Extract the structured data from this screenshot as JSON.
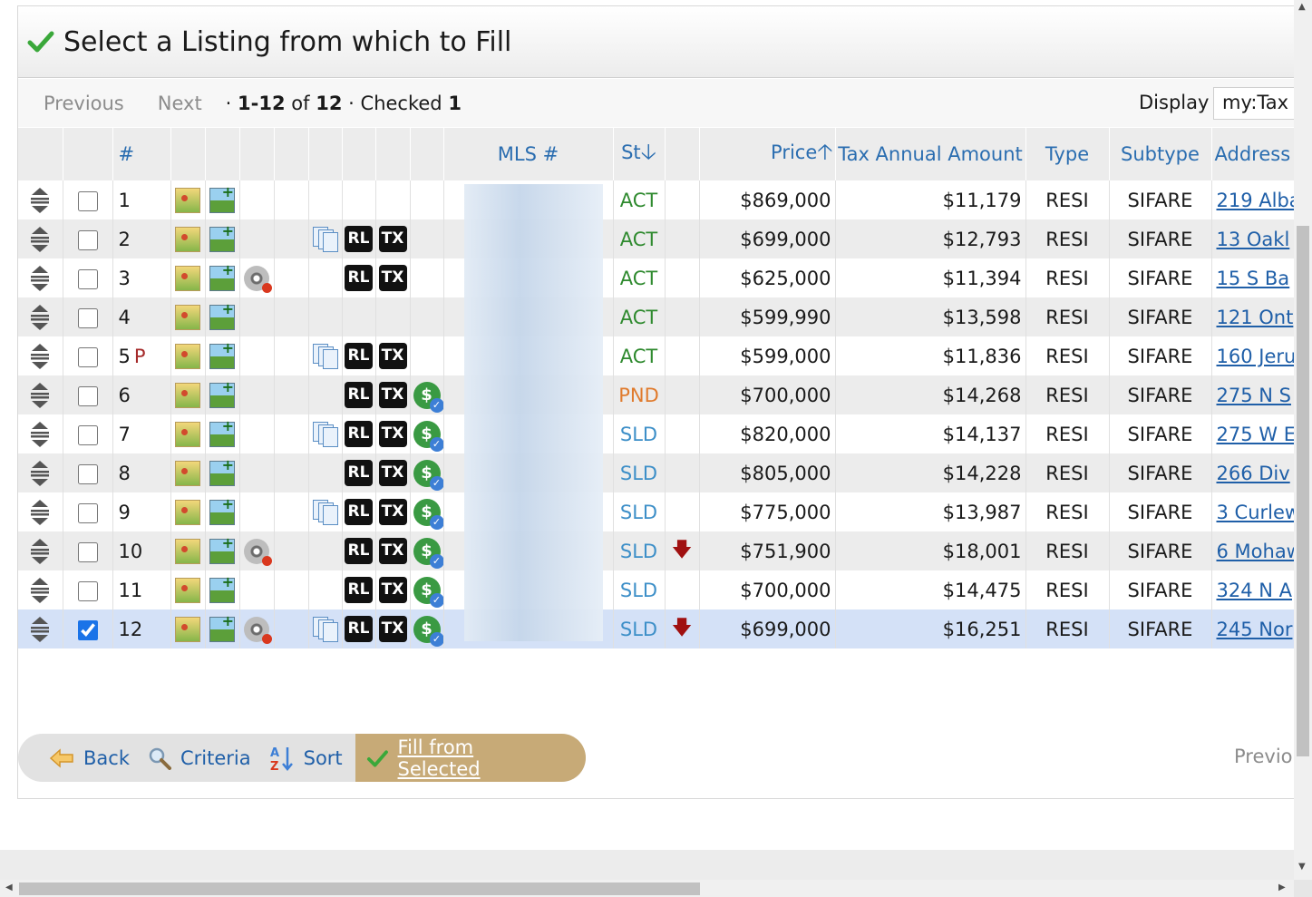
{
  "page": {
    "title": "Select a Listing from which to Fill"
  },
  "pager": {
    "previous": "Previous",
    "next": "Next",
    "sep1": "·",
    "range": "1-12",
    "of": "of",
    "total": "12",
    "sep2": "·",
    "checked_label": "Checked",
    "checked_count": "1",
    "display_label": "Display",
    "display_value": "my:Tax"
  },
  "columns": {
    "num": "#",
    "mls": "MLS #",
    "status": "St",
    "price": "Price",
    "tax": "Tax Annual Amount",
    "type": "Type",
    "subtype": "Subtype",
    "address": "Address"
  },
  "rows": [
    {
      "n": "1",
      "flag": "",
      "checked": false,
      "reel": false,
      "copy": false,
      "rl": false,
      "tx": false,
      "dollar": false,
      "st": "ACT",
      "drop": false,
      "price": "$869,000",
      "tax": "$11,179",
      "type": "RESI",
      "sub": "SIFARE",
      "addr": "219 Alba"
    },
    {
      "n": "2",
      "flag": "",
      "checked": false,
      "reel": false,
      "copy": true,
      "rl": true,
      "tx": true,
      "dollar": false,
      "st": "ACT",
      "drop": false,
      "price": "$699,000",
      "tax": "$12,793",
      "type": "RESI",
      "sub": "SIFARE",
      "addr": "13 Oakl"
    },
    {
      "n": "3",
      "flag": "",
      "checked": false,
      "reel": true,
      "copy": false,
      "rl": true,
      "tx": true,
      "dollar": false,
      "st": "ACT",
      "drop": false,
      "price": "$625,000",
      "tax": "$11,394",
      "type": "RESI",
      "sub": "SIFARE",
      "addr": "15 S Ba"
    },
    {
      "n": "4",
      "flag": "",
      "checked": false,
      "reel": false,
      "copy": false,
      "rl": false,
      "tx": false,
      "dollar": false,
      "st": "ACT",
      "drop": false,
      "price": "$599,990",
      "tax": "$13,598",
      "type": "RESI",
      "sub": "SIFARE",
      "addr": "121 Ont"
    },
    {
      "n": "5",
      "flag": "P",
      "checked": false,
      "reel": false,
      "copy": true,
      "rl": true,
      "tx": true,
      "dollar": false,
      "st": "ACT",
      "drop": false,
      "price": "$599,000",
      "tax": "$11,836",
      "type": "RESI",
      "sub": "SIFARE",
      "addr": "160 Jeru"
    },
    {
      "n": "6",
      "flag": "",
      "checked": false,
      "reel": false,
      "copy": false,
      "rl": true,
      "tx": true,
      "dollar": true,
      "st": "PND",
      "drop": false,
      "price": "$700,000",
      "tax": "$14,268",
      "type": "RESI",
      "sub": "SIFARE",
      "addr": "275 N S"
    },
    {
      "n": "7",
      "flag": "",
      "checked": false,
      "reel": false,
      "copy": true,
      "rl": true,
      "tx": true,
      "dollar": true,
      "st": "SLD",
      "drop": false,
      "price": "$820,000",
      "tax": "$14,137",
      "type": "RESI",
      "sub": "SIFARE",
      "addr": "275 W E"
    },
    {
      "n": "8",
      "flag": "",
      "checked": false,
      "reel": false,
      "copy": false,
      "rl": true,
      "tx": true,
      "dollar": true,
      "st": "SLD",
      "drop": false,
      "price": "$805,000",
      "tax": "$14,228",
      "type": "RESI",
      "sub": "SIFARE",
      "addr": "266 Div"
    },
    {
      "n": "9",
      "flag": "",
      "checked": false,
      "reel": false,
      "copy": true,
      "rl": true,
      "tx": true,
      "dollar": true,
      "st": "SLD",
      "drop": false,
      "price": "$775,000",
      "tax": "$13,987",
      "type": "RESI",
      "sub": "SIFARE",
      "addr": "3 Curlew"
    },
    {
      "n": "10",
      "flag": "",
      "checked": false,
      "reel": true,
      "copy": false,
      "rl": true,
      "tx": true,
      "dollar": true,
      "st": "SLD",
      "drop": true,
      "price": "$751,900",
      "tax": "$18,001",
      "type": "RESI",
      "sub": "SIFARE",
      "addr": "6 Mohaw"
    },
    {
      "n": "11",
      "flag": "",
      "checked": false,
      "reel": false,
      "copy": false,
      "rl": true,
      "tx": true,
      "dollar": true,
      "st": "SLD",
      "drop": false,
      "price": "$700,000",
      "tax": "$14,475",
      "type": "RESI",
      "sub": "SIFARE",
      "addr": "324 N A"
    },
    {
      "n": "12",
      "flag": "",
      "checked": true,
      "reel": true,
      "copy": true,
      "rl": true,
      "tx": true,
      "dollar": true,
      "st": "SLD",
      "drop": true,
      "price": "$699,000",
      "tax": "$16,251",
      "type": "RESI",
      "sub": "SIFARE",
      "addr": "245 Nor"
    }
  ],
  "badges": {
    "rl": "RL",
    "tx": "TX",
    "dollar": "$"
  },
  "buttons": {
    "back": "Back",
    "criteria": "Criteria",
    "sort": "Sort",
    "fill": "Fill from Selected",
    "previous_bottom": "Previo"
  },
  "colors": {
    "accent": "#c7aa77",
    "link": "#1f5fa8",
    "act": "#2f8a2f",
    "pnd": "#e07b2d",
    "sld": "#3d8fc8"
  }
}
